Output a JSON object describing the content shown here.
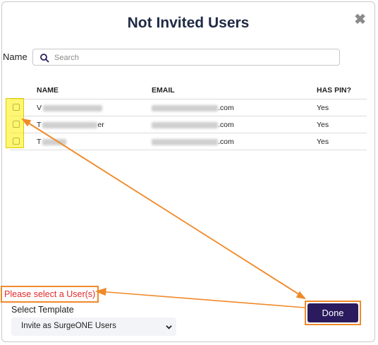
{
  "dialog": {
    "title": "Not Invited Users",
    "close_icon": "close-icon"
  },
  "search": {
    "label": "Name",
    "placeholder": "Search",
    "value": ""
  },
  "table": {
    "columns": [
      "NAME",
      "EMAIL",
      "HAS PIN?"
    ],
    "rows": [
      {
        "name_prefix": "V",
        "name_suffix": "",
        "email_suffix": ".com",
        "has_pin": "Yes",
        "checked": false
      },
      {
        "name_prefix": "T",
        "name_suffix": "er",
        "email_suffix": ".com",
        "has_pin": "Yes",
        "checked": false
      },
      {
        "name_prefix": "T",
        "name_suffix": "",
        "email_suffix": ".com",
        "has_pin": "Yes",
        "checked": false
      }
    ]
  },
  "annotations": {
    "error": "Please select a User(s)",
    "highlight_color": "#fff000",
    "arrow_color": "#f08a2a"
  },
  "footer": {
    "template_label": "Select Template",
    "template_value": "Invite as SurgeONE Users",
    "done_label": "Done",
    "done_color": "#2b1b5e"
  }
}
